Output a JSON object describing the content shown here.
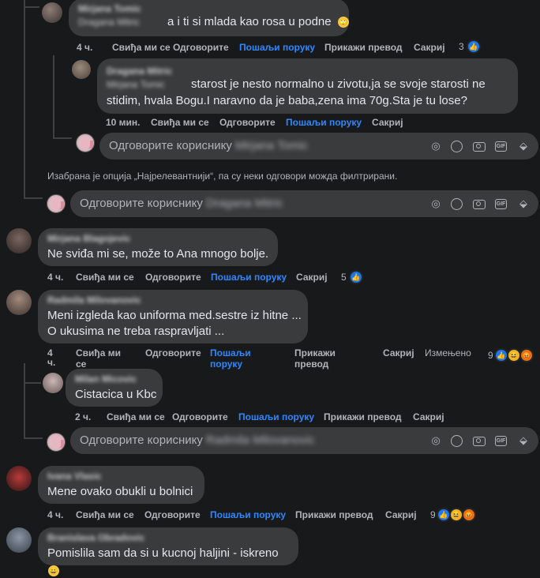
{
  "actions_labels": {
    "like": "Свиђа ми се",
    "reply": "Одговорите",
    "send_message": "Пошаљи поруку",
    "translate": "Прикажи превод",
    "hide": "Сакриј",
    "edited": "Измењено"
  },
  "reply_placeholder": "Одговорите кориснику",
  "filter_notice": "Изабрана је опција „Најрелевантнији“, па су неки одговори можда филтрирани.",
  "comments": [
    {
      "author": "Mirjana Tomic",
      "author_line2": "Dragana Mitric",
      "text": "a i ti si mlada kao rosa u podne",
      "time": "4 ч.",
      "reactions_count": "3",
      "emoji": "🙄"
    },
    {
      "author": "Dragana Mitric",
      "author_line2": "Mirjana Tomic",
      "text_line1": "starost je nesto normalno u zivotu,ja se svoje starosti ne",
      "text_line2": "stidim, hvala Bogu.I naravno da je baba,zena ima 70g.Sta je tu lose?",
      "time": "10 мин."
    },
    {
      "author": "Mirjana Blagojevic",
      "text": "Ne sviđa mi se, može to Ana mnogo bolje.",
      "time": "4 ч.",
      "reactions_count": "5"
    },
    {
      "author": "Radmila Milovanovic",
      "text_line1": "Meni izgleda kao uniforma med.sestre iz hitne ...",
      "text_line2": "O ukusima ne treba raspravljati ...",
      "time": "4",
      "time_unit": "ч.",
      "reactions_count": "9"
    },
    {
      "author": "Milan Micovic",
      "text": "Cistacica u Kbc",
      "time": "2 ч."
    },
    {
      "author": "Ivana Vlasic",
      "text": "Mene ovako obukli u bolnici",
      "time": "4 ч.",
      "reactions_count": "9"
    },
    {
      "author": "Branislava Obradovic",
      "text": "Pomislila sam da si u kucnoj haljini - iskreno",
      "emoji": "😀"
    }
  ],
  "reply_targets": [
    "Mirjana Tomic",
    "Dragana Mitric",
    "Radmila Milovanovic"
  ],
  "reply_icons": [
    "sticker-face-icon",
    "emoji-icon",
    "camera-icon",
    "gif-icon",
    "sticker-icon"
  ],
  "gif_label": "GIF",
  "colors": {
    "background": "#18191a",
    "bubble": "#3a3b3c",
    "link": "#2d88ff",
    "muted": "#b0b3b8"
  }
}
